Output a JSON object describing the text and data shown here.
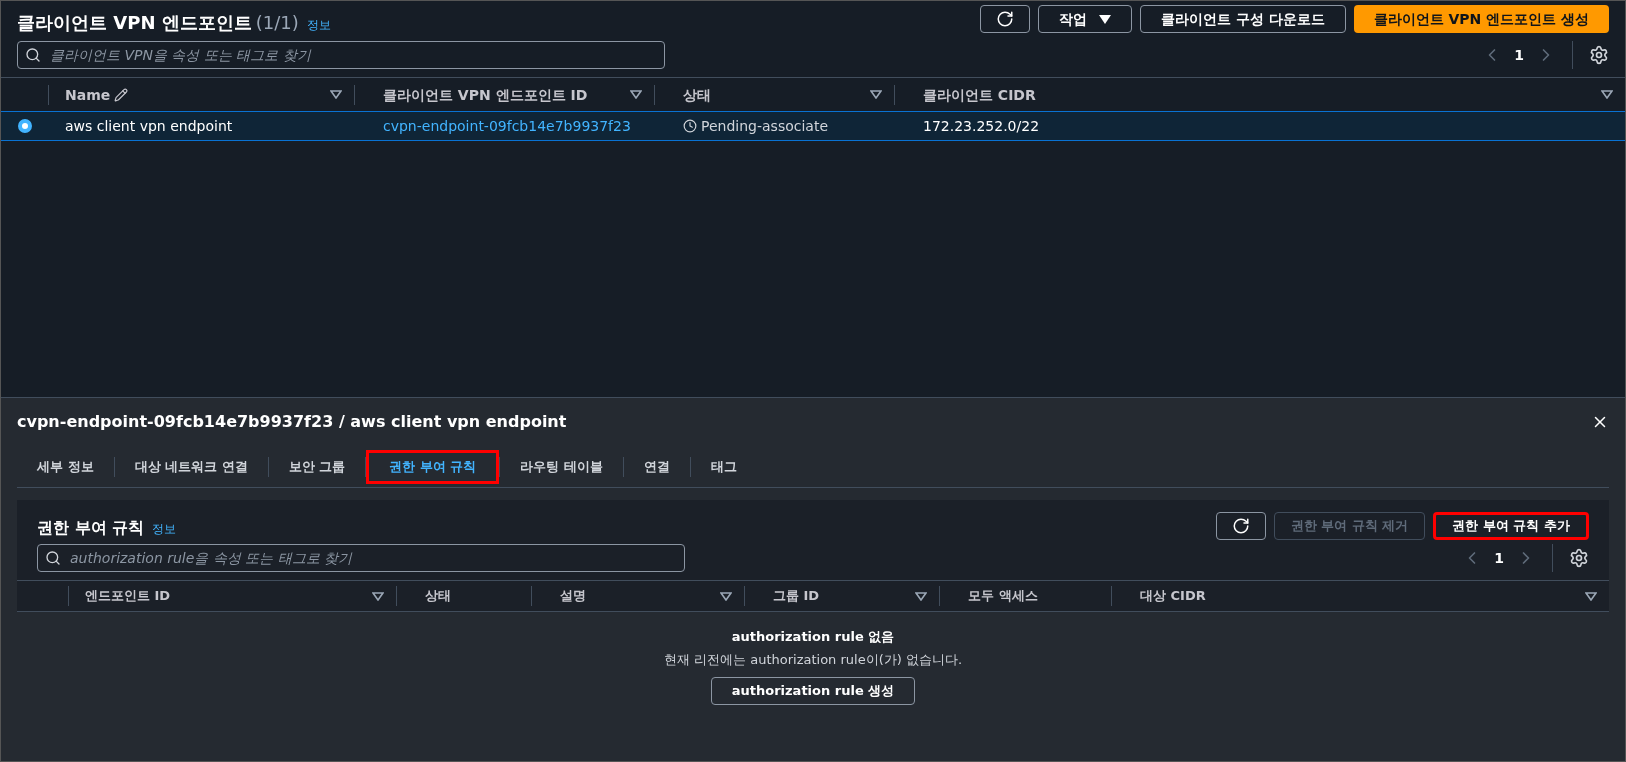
{
  "header": {
    "title": "클라이언트 VPN 엔드포인트",
    "count": "(1/1)",
    "info_link": "정보",
    "actions_button": "작업",
    "download_button": "클라이언트 구성 다운로드",
    "create_button": "클라이언트 VPN 엔드포인트 생성"
  },
  "search": {
    "placeholder": "클라이언트 VPN을 속성 또는 태그로 찾기"
  },
  "pagination": {
    "page": "1"
  },
  "table": {
    "columns": [
      {
        "label": "Name",
        "editable": true,
        "sortable": true
      },
      {
        "label": "클라이언트 VPN 엔드포인트 ID",
        "editable": false,
        "sortable": true
      },
      {
        "label": "상태",
        "editable": false,
        "sortable": true
      },
      {
        "label": "클라이언트 CIDR",
        "editable": false,
        "sortable": true
      }
    ],
    "rows": [
      {
        "selected": true,
        "name": "aws client vpn endpoint",
        "id": "cvpn-endpoint-09fcb14e7b9937f23",
        "status": "Pending-associate",
        "cidr": "172.23.252.0/22"
      }
    ]
  },
  "detail": {
    "title": "cvpn-endpoint-09fcb14e7b9937f23 / aws client vpn endpoint",
    "tabs": [
      {
        "label": "세부 정보",
        "selected": false,
        "highlighted": false
      },
      {
        "label": "대상 네트워크 연결",
        "selected": false,
        "highlighted": false
      },
      {
        "label": "보안 그룹",
        "selected": false,
        "highlighted": false
      },
      {
        "label": "권한 부여 규칙",
        "selected": true,
        "highlighted": true
      },
      {
        "label": "라우팅 테이블",
        "selected": false,
        "highlighted": false
      },
      {
        "label": "연결",
        "selected": false,
        "highlighted": false
      },
      {
        "label": "태그",
        "selected": false,
        "highlighted": false
      }
    ],
    "section": {
      "title": "권한 부여 규칙",
      "info_link": "정보",
      "remove_button": {
        "label": "권한 부여 규칙 제거",
        "disabled": true,
        "highlighted": false
      },
      "add_button": {
        "label": "권한 부여 규칙 추가",
        "disabled": false,
        "highlighted": true
      },
      "search": {
        "placeholder": "authorization rule을 속성 또는 태그로 찾기"
      },
      "page": "1",
      "columns": [
        {
          "label": "엔드포인트 ID",
          "sortable": true
        },
        {
          "label": "상태",
          "sortable": false
        },
        {
          "label": "설명",
          "sortable": true
        },
        {
          "label": "그룹 ID",
          "sortable": true
        },
        {
          "label": "모두 액세스",
          "sortable": false
        },
        {
          "label": "대상 CIDR",
          "sortable": true
        }
      ],
      "empty": {
        "title": "authorization rule 없음",
        "message": "현재 리전에는 authorization rule이(가) 없습니다.",
        "button": "authorization rule 생성"
      }
    }
  }
}
